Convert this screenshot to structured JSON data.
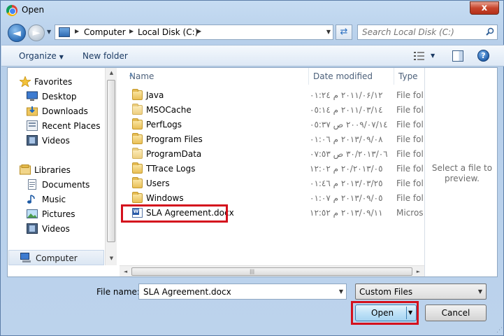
{
  "window": {
    "title": "Open",
    "close_label": "x"
  },
  "address": {
    "crumbs": [
      "Computer",
      "Local Disk (C:)"
    ]
  },
  "search": {
    "placeholder": "Search Local Disk (C:)"
  },
  "toolbar": {
    "organize_label": "Organize",
    "new_folder_label": "New folder"
  },
  "nav": {
    "favorites": {
      "label": "Favorites",
      "items": [
        "Desktop",
        "Downloads",
        "Recent Places",
        "Videos"
      ]
    },
    "libraries": {
      "label": "Libraries",
      "items": [
        "Documents",
        "Music",
        "Pictures",
        "Videos"
      ]
    },
    "computer_label": "Computer"
  },
  "columns": {
    "name": "Name",
    "date": "Date modified",
    "type": "Type"
  },
  "files": [
    {
      "name": "Java",
      "date": "۲۰۱۱/۰۶/۱۲ م ۰۱:۲٤",
      "type": "File fol",
      "kind": "folder"
    },
    {
      "name": "MSOCache",
      "date": "۲۰۱۱/۰۳/۱٤ م ۰٥:۱٤",
      "type": "File fol",
      "kind": "folder"
    },
    {
      "name": "PerfLogs",
      "date": "۲۰۰۹/۰۷/۱٤ ص ۰٥:۳۷",
      "type": "File fol",
      "kind": "folder"
    },
    {
      "name": "Program Files",
      "date": "۲۰۱۳/۰۹/۰۸ م ۰۱:۰٦",
      "type": "File fol",
      "kind": "folder"
    },
    {
      "name": "ProgramData",
      "date": "۲۰۱۳/۰٦/۳۰ ص ۰۷:٥۳",
      "type": "File fol",
      "kind": "folder"
    },
    {
      "name": "TTrace Logs",
      "date": "۲۰۱۳/۰٥/۲۰ م ۱۲:۰۲",
      "type": "File fol",
      "kind": "folder"
    },
    {
      "name": "Users",
      "date": "۲۰۱۳/۰۳/۲٥ م ۰۱:٤٦",
      "type": "File fol",
      "kind": "folder"
    },
    {
      "name": "Windows",
      "date": "۲۰۱۳/۰۹/۰٥ م ۰۱:۰۷",
      "type": "File fol",
      "kind": "folder"
    },
    {
      "name": "SLA Agreement.docx",
      "date": "۲۰۱۳/۰۹/۱۱ م ۱۲:٥۲",
      "type": "Micros",
      "kind": "docx"
    }
  ],
  "preview": {
    "text": "Select a file to preview."
  },
  "footer": {
    "file_name_label": "File name:",
    "file_name_value": "SLA Agreement.docx",
    "filter_value": "Custom Files",
    "open_label": "Open",
    "cancel_label": "Cancel"
  }
}
